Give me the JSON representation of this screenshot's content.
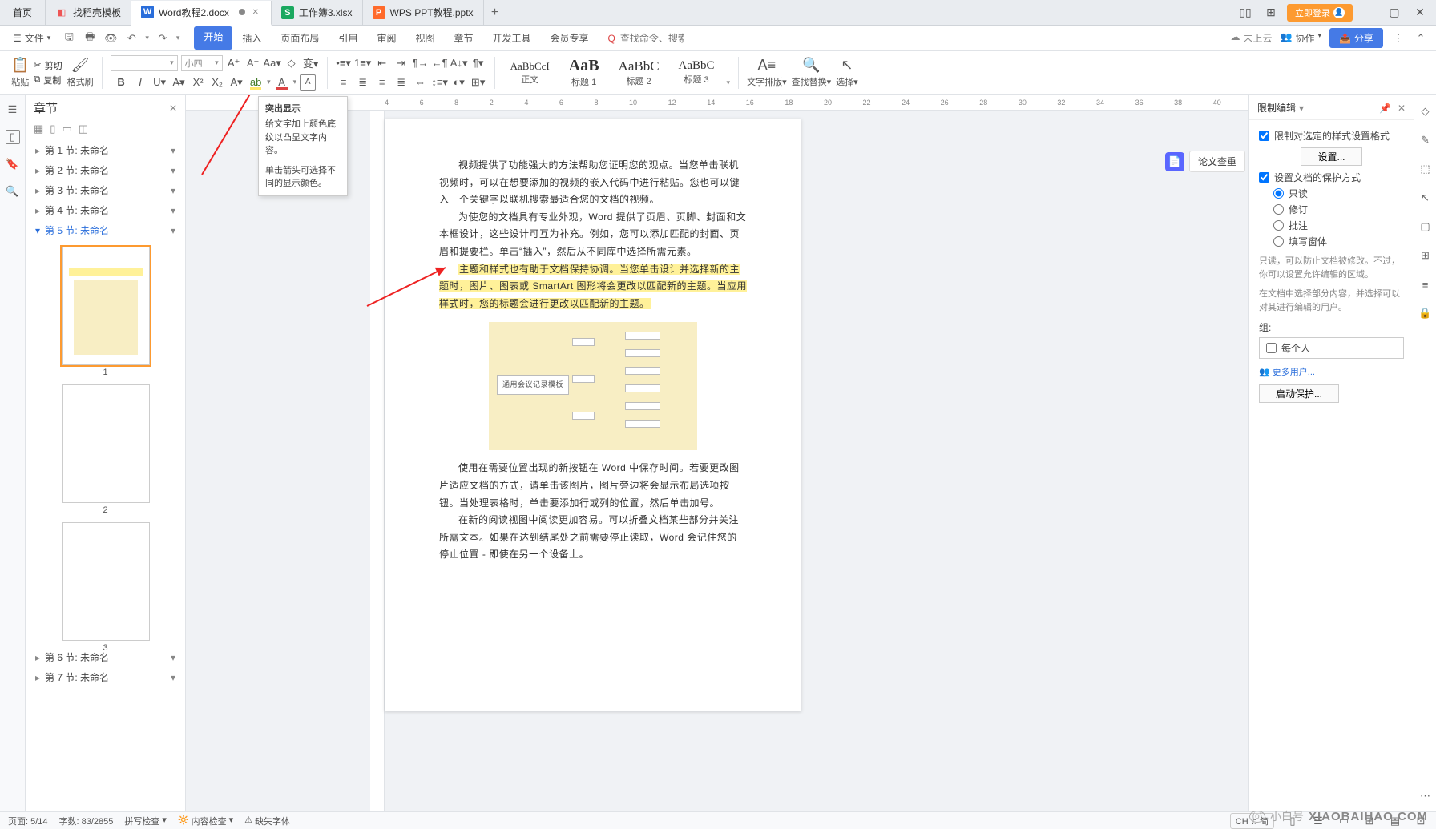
{
  "title_bar": {
    "home": "首页",
    "tabs": [
      {
        "icon": "🧊",
        "icon_color": "#e55",
        "label": "找稻壳模板"
      },
      {
        "icon": "W",
        "icon_color": "#2a6edb",
        "label": "Word教程2.docx",
        "active": true
      },
      {
        "icon": "S",
        "icon_color": "#1aa85f",
        "label": "工作簿3.xlsx"
      },
      {
        "icon": "P",
        "icon_color": "#ff6a2b",
        "label": "WPS PPT教程.pptx"
      }
    ],
    "login": "立即登录",
    "win": {
      "grid": "▦",
      "apps": "⊞"
    }
  },
  "menu": {
    "file_icon": "☰",
    "file": "文件",
    "tabs": [
      "开始",
      "插入",
      "页面布局",
      "引用",
      "审阅",
      "视图",
      "章节",
      "开发工具",
      "会员专享"
    ],
    "active_idx": 0,
    "search_placeholder": "查找命令、搜索模板",
    "cloud": "未上云",
    "coop": "协作",
    "share": "分享"
  },
  "ribbon": {
    "paste": "粘贴",
    "cut": "剪切",
    "copy": "复制",
    "fmt": "格式刷",
    "font_name": "",
    "font_size": "小四",
    "styles": [
      {
        "prev": "AaBbCcI",
        "lbl": "正文",
        "fs": "13px"
      },
      {
        "prev": "AaB",
        "lbl": "标题 1",
        "fs": "20px",
        "bold": true
      },
      {
        "prev": "AaBbC",
        "lbl": "标题 2",
        "fs": "17px"
      },
      {
        "prev": "AaBbC",
        "lbl": "标题 3",
        "fs": "15px"
      }
    ],
    "textlayout": "文字排版",
    "findrep": "查找替换",
    "select": "选择"
  },
  "tooltip": {
    "title": "突出显示",
    "line1": "给文字加上颜色底纹以凸显文字内容。",
    "line2": "单击箭头可选择不同的显示颜色。"
  },
  "nav": {
    "title": "章节",
    "chapters": [
      "第 1 节: 未命名",
      "第 2 节: 未命名",
      "第 3 节: 未命名",
      "第 4 节: 未命名",
      "第 5 节: 未命名",
      "第 6 节: 未命名",
      "第 7 节: 未命名"
    ],
    "active_idx": 4,
    "thumbs": [
      1,
      2,
      3
    ]
  },
  "doc": {
    "p1": "视频提供了功能强大的方法帮助您证明您的观点。当您单击联机视频时，可以在想要添加的视频的嵌入代码中进行粘贴。您也可以键入一个关键字以联机搜索最适合您的文档的视频。",
    "p2": "为使您的文档具有专业外观，Word 提供了页眉、页脚、封面和文本框设计，这些设计可互为补充。例如，您可以添加匹配的封面、页眉和提要栏。单击“插入”，然后从不同库中选择所需元素。",
    "hl": "主题和样式也有助于文档保持协调。当您单击设计并选择新的主题时，图片、图表或 SmartArt 图形将会更改以匹配新的主题。当应用样式时，您的标题会进行更改以匹配新的主题。",
    "diag_label": "通用会议记录模板",
    "p3": "使用在需要位置出现的新按钮在 Word 中保存时间。若要更改图片适应文档的方式，请单击该图片，图片旁边将会显示布局选项按钮。当处理表格时，单击要添加行或列的位置，然后单击加号。",
    "p4": "在新的阅读视图中阅读更加容易。可以折叠文档某些部分并关注所需文本。如果在达到结尾处之前需要停止读取，Word 会记住您的停止位置 - 即使在另一个设备上。"
  },
  "float": {
    "label": "论文查重"
  },
  "rpanel": {
    "title": "限制编辑",
    "cb1": "限制对选定的样式设置格式",
    "settings": "设置...",
    "cb2": "设置文档的保护方式",
    "radios": [
      "只读",
      "修订",
      "批注",
      "填写窗体"
    ],
    "desc1": "只读，可以防止文档被修改。不过，你可以设置允许编辑的区域。",
    "desc2": "在文档中选择部分内容，并选择可以对其进行编辑的用户。",
    "group": "组:",
    "everyone": "每个人",
    "moreuser": "更多用户...",
    "start": "启动保护..."
  },
  "status": {
    "page": "页面: 5/14",
    "words": "字数: 83/2855",
    "spell": "拼写检查",
    "compat": "内容检查",
    "missing": "缺失字体",
    "ime": "CH ♫ 简"
  },
  "ruler_marks": [
    "4",
    "6",
    "8",
    "2",
    "4",
    "6",
    "8",
    "10",
    "12",
    "14",
    "16",
    "18",
    "20",
    "22",
    "24",
    "26",
    "28",
    "30",
    "32",
    "34",
    "36",
    "38",
    "40"
  ],
  "watermark": "XIAOBAIHAO.COM",
  "wm_small": "小白号"
}
